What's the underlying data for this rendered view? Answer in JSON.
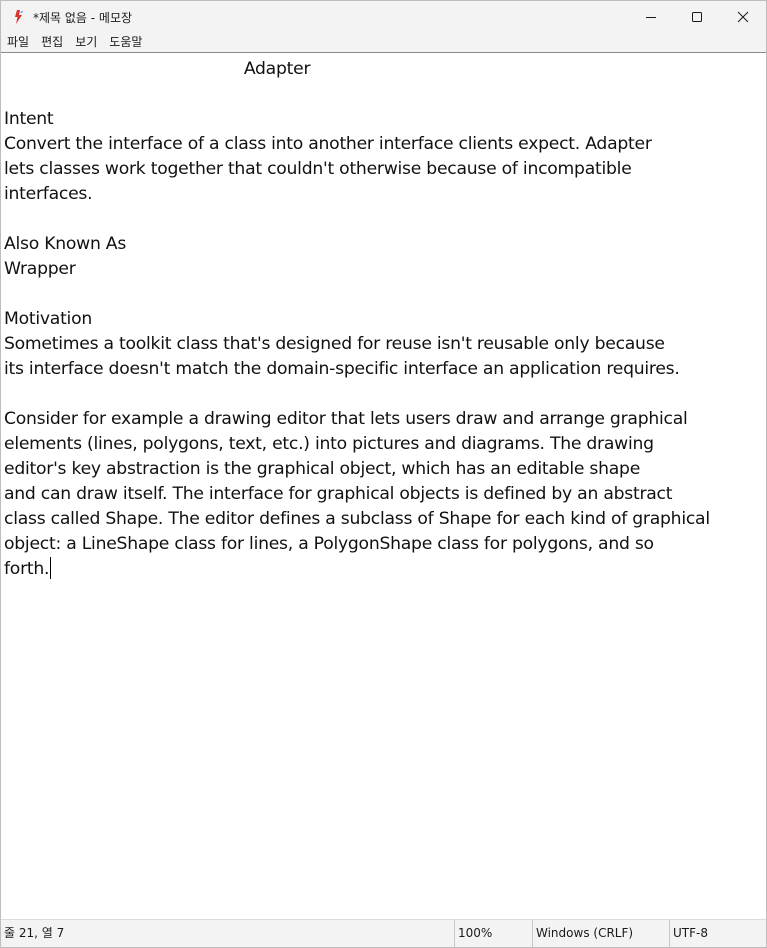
{
  "window": {
    "title": "*제목 없음 - 메모장"
  },
  "menu": [
    "파일",
    "편집",
    "보기",
    "도움말"
  ],
  "editor": {
    "lines": [
      "                                              Adapter",
      "",
      "Intent",
      "Convert the interface of a class into another interface clients expect. Adapter",
      "lets classes work together that couldn't otherwise because of incompatible",
      "interfaces.",
      "",
      "Also Known As",
      "Wrapper",
      "",
      "Motivation",
      "Sometimes a toolkit class that's designed for reuse isn't reusable only because",
      "its interface doesn't match the domain-specific interface an application requires.",
      "",
      "Consider for example a drawing editor that lets users draw and arrange graphical",
      "elements (lines, polygons, text, etc.) into pictures and diagrams. The drawing",
      "editor's key abstraction is the graphical object, which has an editable shape",
      "and can draw itself. The interface for graphical objects is defined by an abstract",
      "class called Shape. The editor defines a subclass of Shape for each kind of graphical",
      "object: a LineShape class for lines, a PolygonShape class for polygons, and so",
      "forth."
    ]
  },
  "status": {
    "position": "줄 21, 열 7",
    "zoom": "100%",
    "line_ending": "Windows (CRLF)",
    "encoding": "UTF-8"
  },
  "icons": {
    "app": "notepad-icon",
    "minimize": "minimize-icon",
    "maximize": "maximize-icon",
    "close": "close-icon"
  }
}
